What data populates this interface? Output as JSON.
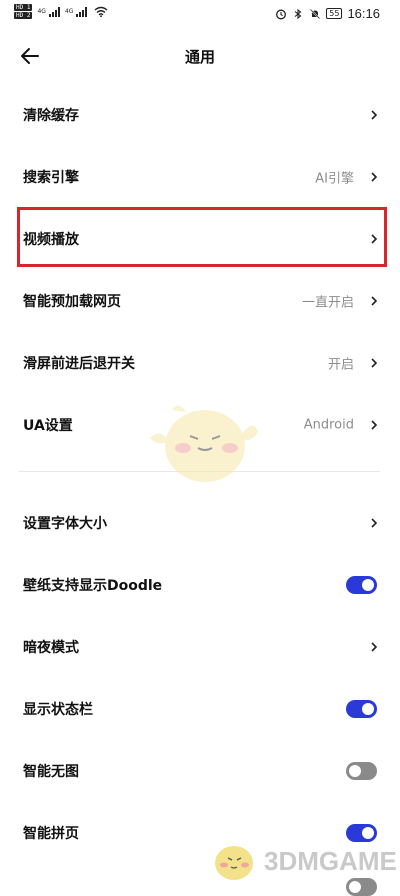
{
  "status_bar": {
    "sim1": "HD 1",
    "sim2": "HD 2",
    "network": "4G",
    "battery": "55",
    "time": "16:16"
  },
  "header": {
    "title": "通用"
  },
  "rows": [
    {
      "label": "清除缓存",
      "value": "",
      "control": "chevron"
    },
    {
      "label": "搜索引擎",
      "value": "AI引擎",
      "control": "chevron"
    },
    {
      "label": "视频播放",
      "value": "",
      "control": "chevron"
    },
    {
      "label": "智能预加载网页",
      "value": "一直开启",
      "control": "chevron"
    },
    {
      "label": "滑屏前进后退开关",
      "value": "开启",
      "control": "chevron"
    },
    {
      "label": "UA设置",
      "value": "Android",
      "control": "chevron"
    },
    {
      "label": "设置字体大小",
      "value": "",
      "control": "chevron"
    },
    {
      "label": "壁纸支持显示Doodle",
      "value": "",
      "control": "toggle",
      "on": true
    },
    {
      "label": "暗夜模式",
      "value": "",
      "control": "chevron"
    },
    {
      "label": "显示状态栏",
      "value": "",
      "control": "toggle",
      "on": true
    },
    {
      "label": "智能无图",
      "value": "",
      "control": "toggle",
      "on": false
    },
    {
      "label": "智能拼页",
      "value": "",
      "control": "toggle",
      "on": true
    }
  ],
  "watermark": {
    "text": "3DMGAME"
  },
  "colors": {
    "toggle_on": "#2b39d8",
    "toggle_off": "#8a8a8a",
    "highlight_border": "#d9262c",
    "value_text": "#8d8d8d"
  }
}
